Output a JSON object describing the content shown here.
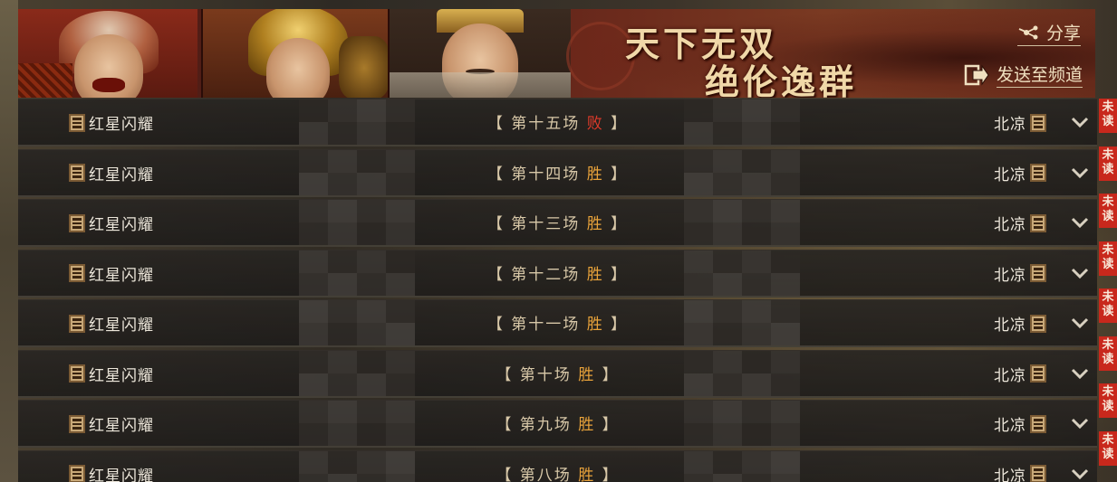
{
  "banner": {
    "title_line1": "天下无双",
    "title_line2": "绝伦逸群",
    "share_label": "分享",
    "send_label": "发送至频道"
  },
  "battles": [
    {
      "left_player": "红星闪耀",
      "prefix": "【 第十五场 ",
      "result": "败",
      "suffix": " 】",
      "result_type": "lose",
      "right_player": "北凉",
      "unread": "未读"
    },
    {
      "left_player": "红星闪耀",
      "prefix": "【 第十四场 ",
      "result": "胜",
      "suffix": " 】",
      "result_type": "win",
      "right_player": "北凉",
      "unread": "未读"
    },
    {
      "left_player": "红星闪耀",
      "prefix": "【 第十三场 ",
      "result": "胜",
      "suffix": " 】",
      "result_type": "win",
      "right_player": "北凉",
      "unread": "未读"
    },
    {
      "left_player": "红星闪耀",
      "prefix": "【 第十二场 ",
      "result": "胜",
      "suffix": " 】",
      "result_type": "win",
      "right_player": "北凉",
      "unread": "未读"
    },
    {
      "left_player": "红星闪耀",
      "prefix": "【 第十一场 ",
      "result": "胜",
      "suffix": " 】",
      "result_type": "win",
      "right_player": "北凉",
      "unread": "未读"
    },
    {
      "left_player": "红星闪耀",
      "prefix": "【 第十场 ",
      "result": "胜",
      "suffix": " 】",
      "result_type": "win",
      "right_player": "北凉",
      "unread": "未读"
    },
    {
      "left_player": "红星闪耀",
      "prefix": "【 第九场 ",
      "result": "胜",
      "suffix": " 】",
      "result_type": "win",
      "right_player": "北凉",
      "unread": "未读"
    },
    {
      "left_player": "红星闪耀",
      "prefix": "【 第八场 ",
      "result": "胜",
      "suffix": " 】",
      "result_type": "win",
      "right_player": "北凉",
      "unread": "未读"
    }
  ],
  "colors": {
    "win": "#e8a23a",
    "lose": "#e03a2a",
    "unread_badge": "#c8281c"
  },
  "icons": {
    "share": "share-icon",
    "send": "send-to-channel-icon",
    "flag": "faction-flag-icon",
    "expand": "chevron-down-icon"
  }
}
